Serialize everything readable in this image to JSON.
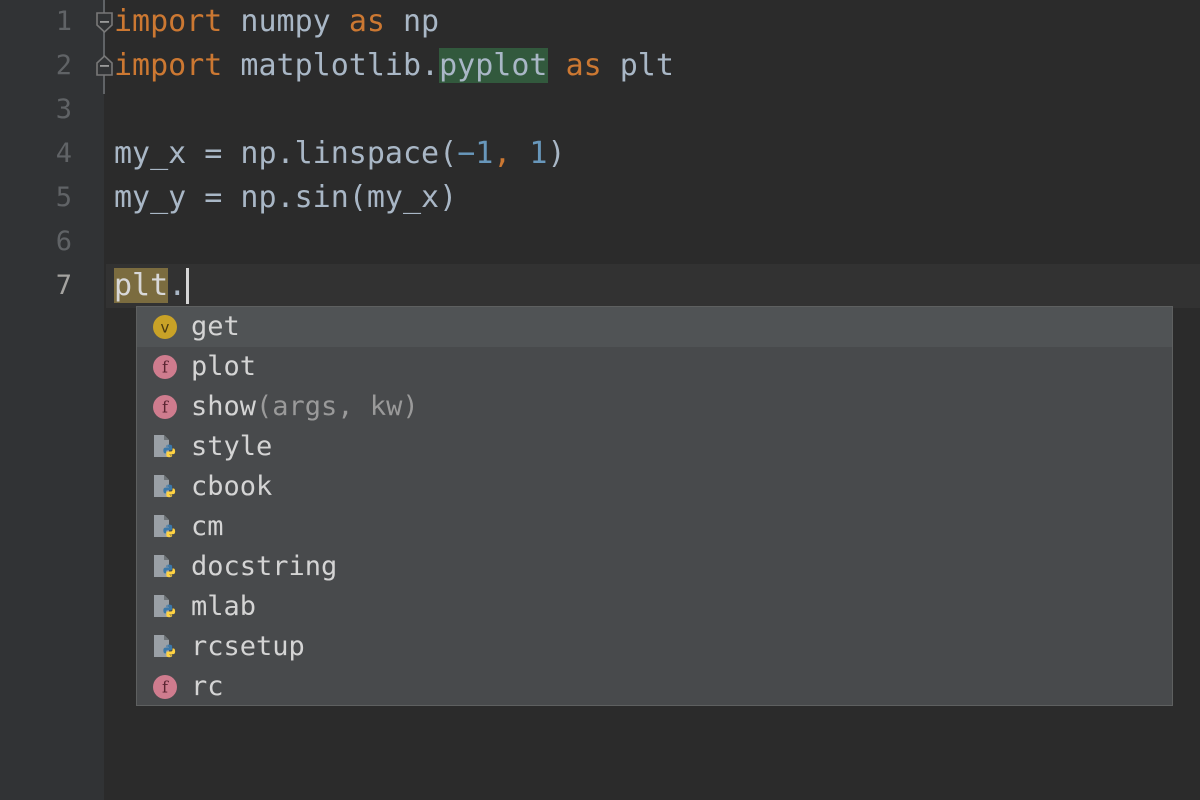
{
  "editor": {
    "background": "#2b2b2b",
    "gutter_background": "#313335",
    "line_numbers": [
      "1",
      "2",
      "3",
      "4",
      "5",
      "6",
      "7"
    ],
    "current_line": 7,
    "line_height": 44,
    "fold_markers": [
      {
        "line": 1,
        "name": "fold-marker-collapse-down",
        "glyph": "minus"
      },
      {
        "line": 2,
        "name": "fold-marker-collapse-up",
        "glyph": "minus"
      }
    ],
    "lines": [
      {
        "number": "1",
        "tokens": [
          {
            "text": "import",
            "kind": "keyword"
          },
          {
            "text": " numpy ",
            "kind": "plain"
          },
          {
            "text": "as",
            "kind": "keyword"
          },
          {
            "text": " np",
            "kind": "plain"
          }
        ]
      },
      {
        "number": "2",
        "tokens": [
          {
            "text": "import",
            "kind": "keyword"
          },
          {
            "text": " matplotlib.",
            "kind": "plain"
          },
          {
            "text": "pyplot",
            "kind": "find-highlight"
          },
          {
            "text": " ",
            "kind": "plain"
          },
          {
            "text": "as",
            "kind": "keyword"
          },
          {
            "text": " plt",
            "kind": "plain"
          }
        ]
      },
      {
        "number": "3",
        "tokens": []
      },
      {
        "number": "4",
        "tokens": [
          {
            "text": "my_x = np.linspace(",
            "kind": "plain"
          },
          {
            "text": "−1",
            "kind": "number"
          },
          {
            "text": ",",
            "kind": "comma"
          },
          {
            "text": " ",
            "kind": "plain"
          },
          {
            "text": "1",
            "kind": "number"
          },
          {
            "text": ")",
            "kind": "plain"
          }
        ]
      },
      {
        "number": "5",
        "tokens": [
          {
            "text": "my_y = np.sin(my_x)",
            "kind": "plain"
          }
        ]
      },
      {
        "number": "6",
        "tokens": []
      },
      {
        "number": "7",
        "tokens": [
          {
            "text": "plt",
            "kind": "prefix-highlight"
          },
          {
            "text": ".",
            "kind": "plain"
          }
        ]
      }
    ],
    "caret": {
      "line": 7,
      "column": 4
    }
  },
  "colors": {
    "keyword": "#cc7832",
    "number": "#6897bb",
    "identifier": "#a9b7c6",
    "find_highlight_bg": "#32593d",
    "prefix_highlight_bg": "#7b6c3f",
    "popup_bg": "#484a4c",
    "popup_selected_bg": "#505355",
    "icon_variable": "#c9a227",
    "icon_function": "#cf7c8e",
    "python_blue": "#3c78a8",
    "python_yellow": "#ffd343"
  },
  "completion_popup": {
    "visible": true,
    "selected_index": 0,
    "items": [
      {
        "label": "get",
        "params": "",
        "icon": "variable-icon"
      },
      {
        "label": "plot",
        "params": "",
        "icon": "function-icon"
      },
      {
        "label": "show",
        "params": "(args, kw)",
        "icon": "function-icon"
      },
      {
        "label": "style",
        "params": "",
        "icon": "python-module-icon"
      },
      {
        "label": "cbook",
        "params": "",
        "icon": "python-module-icon"
      },
      {
        "label": "cm",
        "params": "",
        "icon": "python-module-icon"
      },
      {
        "label": "docstring",
        "params": "",
        "icon": "python-module-icon"
      },
      {
        "label": "mlab",
        "params": "",
        "icon": "python-module-icon"
      },
      {
        "label": "rcsetup",
        "params": "",
        "icon": "python-module-icon"
      },
      {
        "label": "rc",
        "params": "",
        "icon": "function-icon"
      }
    ]
  }
}
